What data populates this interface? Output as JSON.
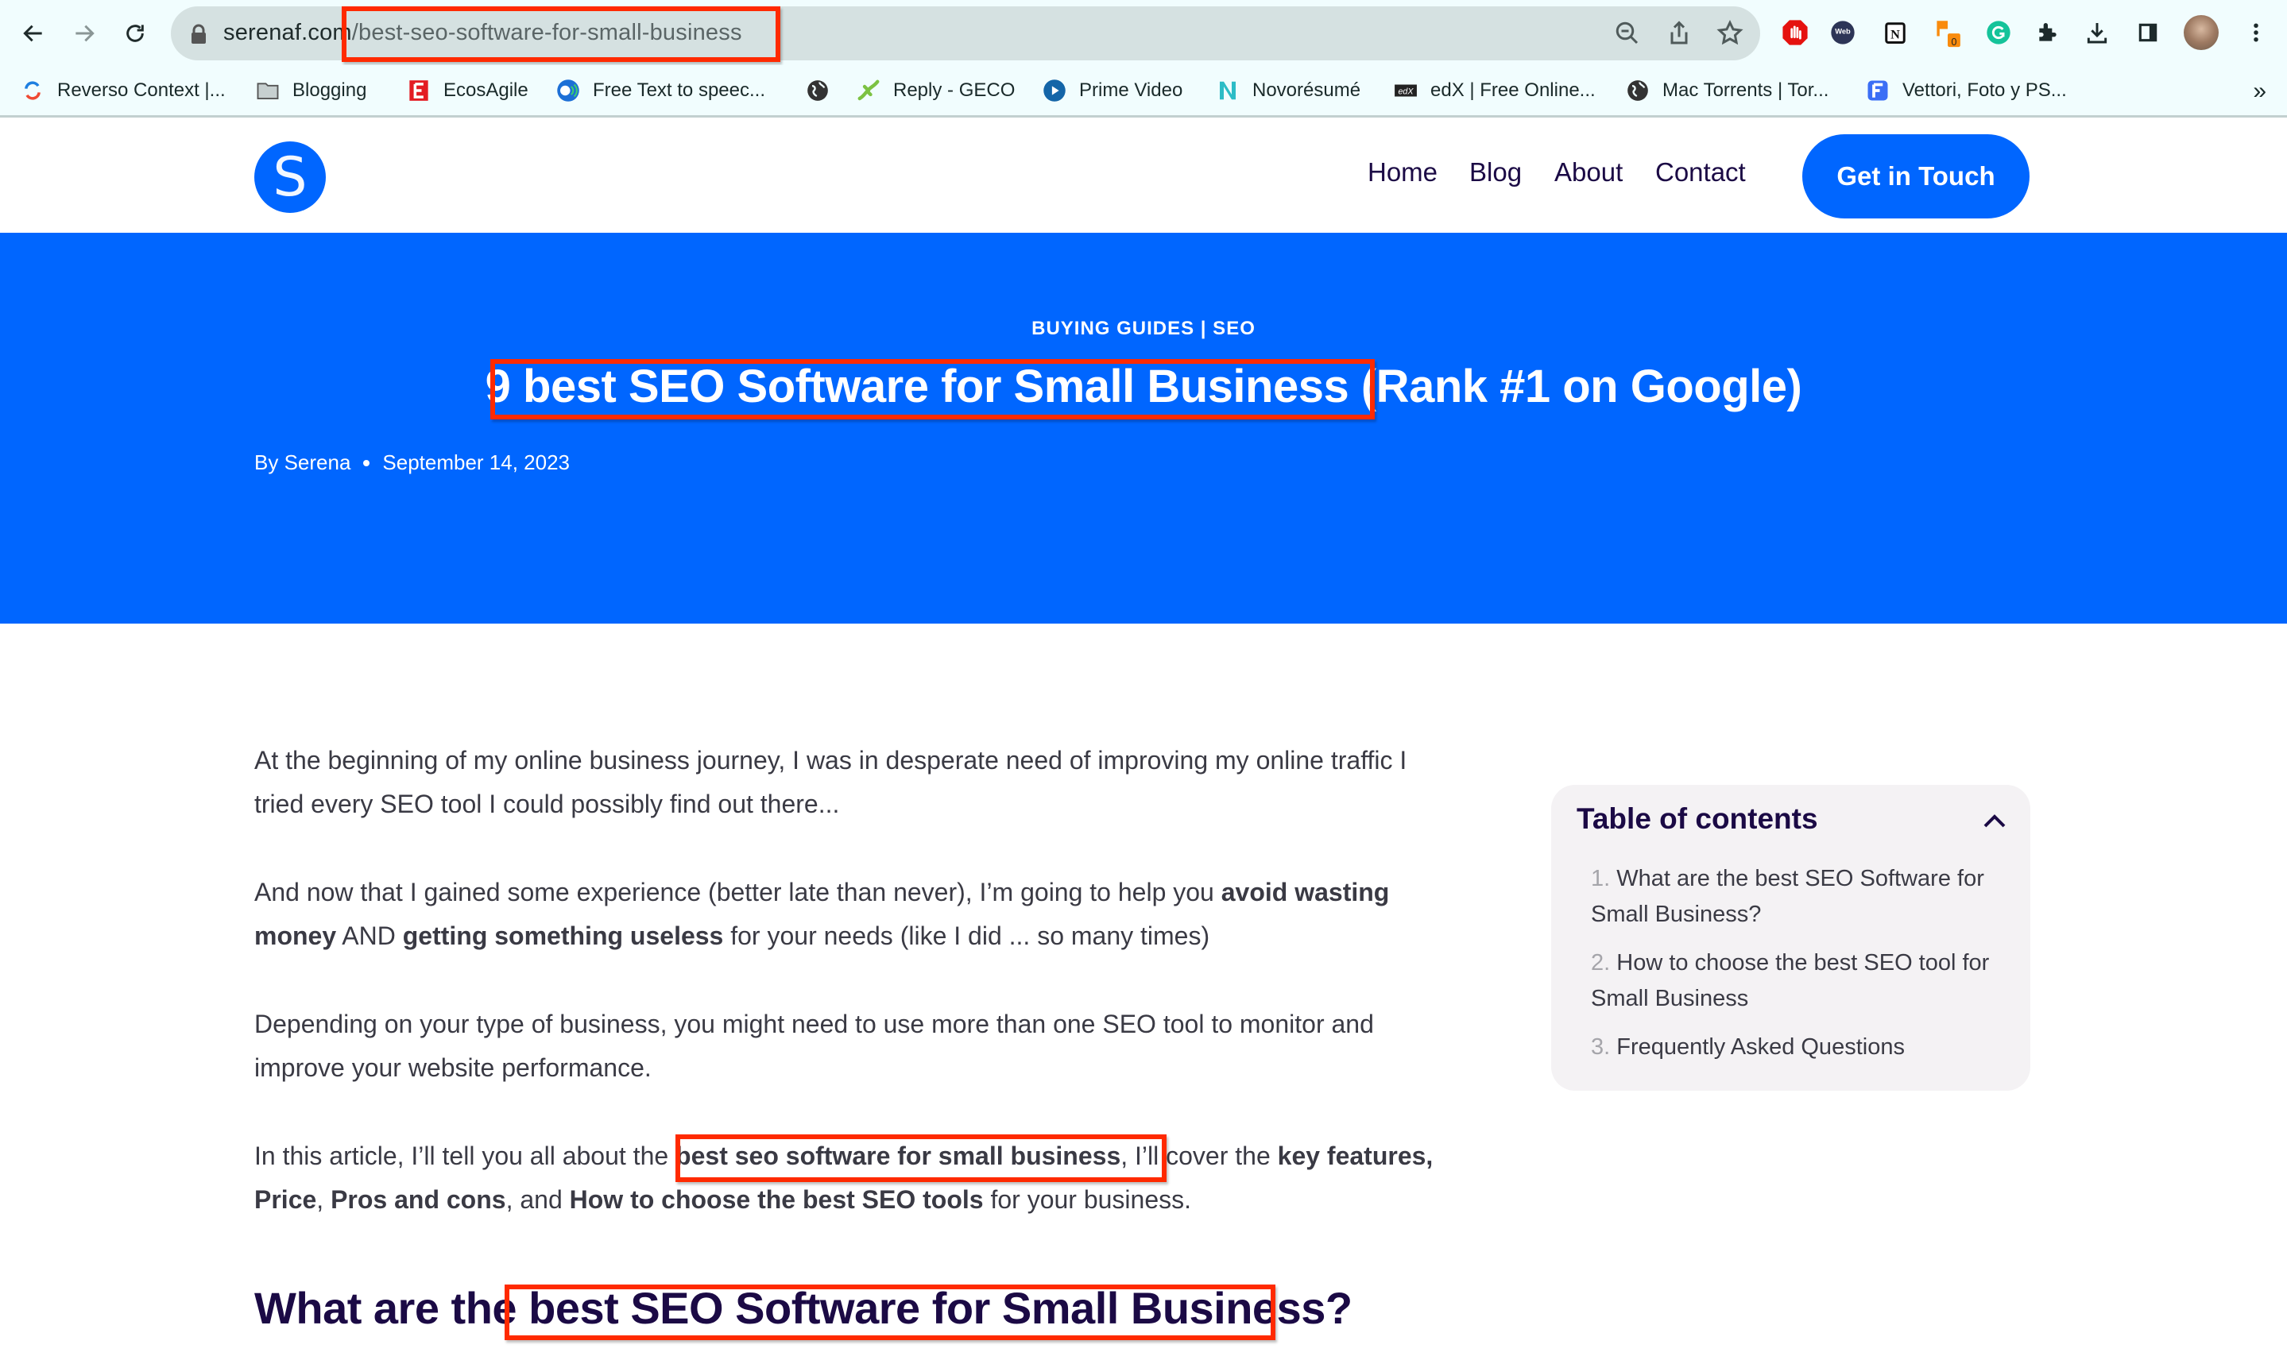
{
  "browser": {
    "url_domain": "serenaf.com",
    "url_path": "/best-seo-software-for-small-business",
    "nav": {
      "back": "back-arrow",
      "forward": "forward-arrow",
      "reload": "reload"
    },
    "omnibox_icons": [
      "zoom-out",
      "share",
      "bookmark-star"
    ],
    "extensions": [
      "adblock",
      "webchatgpt",
      "notion",
      "audio-extension",
      "grammarly",
      "extensions-puzzle",
      "downloads",
      "side-panel",
      "profile-avatar",
      "menu"
    ],
    "extension_badge": "0",
    "bookmarks": [
      {
        "label": "Reverso Context |...",
        "icon": "reverso-icon"
      },
      {
        "label": "Blogging",
        "icon": "folder-icon"
      },
      {
        "label": "EcosAgile",
        "icon": "ecosagile-icon"
      },
      {
        "label": "Free Text to speec...",
        "icon": "tts-icon"
      },
      {
        "label": "",
        "icon": "globe-icon"
      },
      {
        "label": "Reply - GECO",
        "icon": "geco-icon"
      },
      {
        "label": "Prime Video",
        "icon": "prime-video-icon"
      },
      {
        "label": "Novorésumé",
        "icon": "novoresume-icon"
      },
      {
        "label": "edX | Free Online...",
        "icon": "edx-icon"
      },
      {
        "label": "Mac Torrents | Tor...",
        "icon": "globe-icon"
      },
      {
        "label": "Vettori, Foto y PS...",
        "icon": "freepik-icon"
      }
    ],
    "bookmarks_overflow": "»"
  },
  "site": {
    "logo_letter": "S",
    "nav": [
      "Home",
      "Blog",
      "About",
      "Contact"
    ],
    "cta": "Get in Touch",
    "brand_color": "#0066FF",
    "heading_color": "#1B0A45"
  },
  "hero": {
    "categories": "BUYING GUIDES | SEO",
    "title_prefix": "9 ",
    "title_highlight": "best SEO Software for Small Business",
    "title_suffix": " (Rank #1 on Google)",
    "author": "By Serena",
    "date": "September 14, 2023"
  },
  "article": {
    "p1": "At the beginning of my online business journey, I was in desperate need of improving my online traffic I tried every SEO tool I could possibly find out there...",
    "p2": {
      "t1": "And now that I gained some experience (better late than never), I’m going to help you ",
      "b1": "avoid wasting money",
      "t2": " AND ",
      "b2": "getting something useless",
      "t3": " for your needs (like I did ... so many times)"
    },
    "p3": "Depending on your type of business, you might need to use more than one SEO tool to monitor and improve your website performance.",
    "p4": {
      "t1": "In this article, I’ll tell you all about the ",
      "b1": "best seo software for small business",
      "t2": ", I’ll cover the ",
      "b2": "key features, Price",
      "t3": ", ",
      "b3": "Pros and cons",
      "t4": ", and ",
      "b4": "How to choose the best SEO tools",
      "t5": " for your business."
    },
    "h2_prefix": "What are the ",
    "h2_highlight": "best SEO Software for Small Business",
    "h2_suffix": "?"
  },
  "toc": {
    "title": "Table of contents",
    "items": [
      {
        "num": "1.",
        "label": "What are the best SEO Software for Small Business?"
      },
      {
        "num": "2.",
        "label": "How to choose the best SEO tool for Small Business"
      },
      {
        "num": "3.",
        "label": "Frequently Asked Questions"
      }
    ]
  },
  "annotations": {
    "highlight_color": "#FF2A00"
  }
}
